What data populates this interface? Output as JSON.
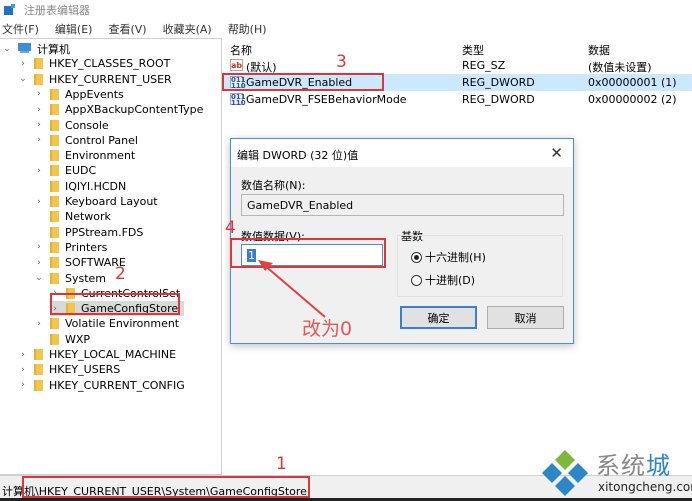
{
  "window": {
    "title": "注册表编辑器"
  },
  "menu": [
    "文件(F)",
    "编辑(E)",
    "查看(V)",
    "收藏夹(A)",
    "帮助(H)"
  ],
  "tree": {
    "root": "计算机",
    "items": [
      {
        "label": "HKEY_CLASSES_ROOT",
        "level": 1,
        "expander": "collapsed"
      },
      {
        "label": "HKEY_CURRENT_USER",
        "level": 1,
        "expander": "expanded"
      },
      {
        "label": "AppEvents",
        "level": 2,
        "expander": "collapsed"
      },
      {
        "label": "AppXBackupContentType",
        "level": 2,
        "expander": "collapsed"
      },
      {
        "label": "Console",
        "level": 2,
        "expander": "collapsed"
      },
      {
        "label": "Control Panel",
        "level": 2,
        "expander": "collapsed"
      },
      {
        "label": "Environment",
        "level": 2,
        "expander": "none"
      },
      {
        "label": "EUDC",
        "level": 2,
        "expander": "collapsed"
      },
      {
        "label": "IQIYI.HCDN",
        "level": 2,
        "expander": "none"
      },
      {
        "label": "Keyboard Layout",
        "level": 2,
        "expander": "collapsed"
      },
      {
        "label": "Network",
        "level": 2,
        "expander": "none"
      },
      {
        "label": "PPStream.FDS",
        "level": 2,
        "expander": "none"
      },
      {
        "label": "Printers",
        "level": 2,
        "expander": "collapsed"
      },
      {
        "label": "SOFTWARE",
        "level": 2,
        "expander": "collapsed"
      },
      {
        "label": "System",
        "level": 2,
        "expander": "expanded"
      },
      {
        "label": "CurrentControlSet",
        "level": 3,
        "expander": "collapsed"
      },
      {
        "label": "GameConfigStore",
        "level": 3,
        "expander": "collapsed",
        "selected": true
      },
      {
        "label": "Volatile Environment",
        "level": 2,
        "expander": "collapsed"
      },
      {
        "label": "WXP",
        "level": 2,
        "expander": "none"
      },
      {
        "label": "HKEY_LOCAL_MACHINE",
        "level": 1,
        "expander": "collapsed"
      },
      {
        "label": "HKEY_USERS",
        "level": 1,
        "expander": "collapsed"
      },
      {
        "label": "HKEY_CURRENT_CONFIG",
        "level": 1,
        "expander": "collapsed"
      }
    ]
  },
  "list": {
    "columns": [
      "名称",
      "类型",
      "数据"
    ],
    "rows": [
      {
        "icon": "ab",
        "name": "(默认)",
        "type": "REG_SZ",
        "data": "(数值未设置)"
      },
      {
        "icon": "dword",
        "name": "GameDVR_Enabled",
        "type": "REG_DWORD",
        "data": "0x00000001 (1)",
        "highlighted": true
      },
      {
        "icon": "dword",
        "name": "GameDVR_FSEBehaviorMode",
        "type": "REG_DWORD",
        "data": "0x00000002 (2)"
      }
    ]
  },
  "statusbar": {
    "path": "计算机\\HKEY_CURRENT_USER\\System\\GameConfigStore"
  },
  "dialog": {
    "title": "编辑 DWORD (32 位)值",
    "close_glyph": "✕",
    "name_label": "数值名称(N):",
    "name_value": "GameDVR_Enabled",
    "data_label": "数值数据(V):",
    "data_value": "1",
    "base_label": "基数",
    "radio_hex": "十六进制(H)",
    "radio_dec": "十进制(D)",
    "ok": "确定",
    "cancel": "取消"
  },
  "annotations": {
    "n1": "1",
    "n2": "2",
    "n3": "3",
    "n4": "4",
    "change_to": "改为0",
    "color": "#d9383a"
  },
  "watermark": {
    "title_gray": "系统",
    "title_blue": "城",
    "url": "xitongcheng.com"
  }
}
